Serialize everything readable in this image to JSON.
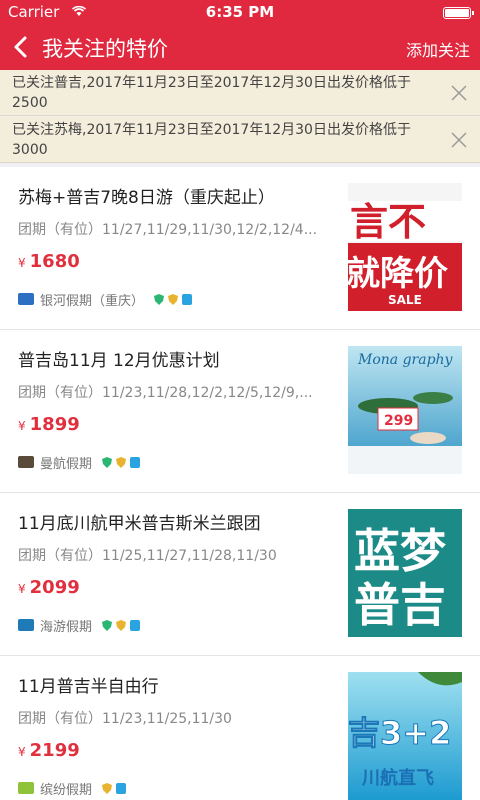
{
  "status_bar": {
    "carrier": "Carrier",
    "time": "6:35 PM"
  },
  "nav": {
    "title": "我关注的特价",
    "right_action": "添加关注"
  },
  "notices": [
    {
      "text": "已关注普吉,2017年11月23日至2017年12月30日出发价格低于2500"
    },
    {
      "text": "已关注苏梅,2017年11月23日至2017年12月30日出发价格低于3000"
    }
  ],
  "items": [
    {
      "name": "苏梅+普吉7晚8日游（重庆起止）",
      "dates": "团期（有位）11/27,11/29,11/30,12/2,12/4...",
      "currency": "¥",
      "price": "1680",
      "agency": "银河假期（重庆）",
      "thumb": {
        "line1": "言不",
        "line2": "就降价",
        "tag": "SALE"
      }
    },
    {
      "name": "普吉岛11月 12月优惠计划",
      "dates": "团期（有位）11/23,11/28,12/2,12/5,12/9,...",
      "currency": "¥",
      "price": "1899",
      "agency": "曼航假期",
      "thumb": {
        "price": "299"
      }
    },
    {
      "name": "11月底川航甲米普吉斯米兰跟团",
      "dates": "团期（有位）11/25,11/27,11/28,11/30",
      "currency": "¥",
      "price": "2099",
      "agency": "海游假期",
      "thumb": {
        "line1": "蓝梦",
        "line2": "普吉"
      }
    },
    {
      "name": "11月普吉半自由行",
      "dates": "团期（有位）11/23,11/25,11/30",
      "currency": "¥",
      "price": "2199",
      "agency": "缤纷假期",
      "thumb": {
        "line1": "吉3+2",
        "line2": "川航直飞"
      }
    }
  ],
  "colors": {
    "brand_red": "#e0283f",
    "price_red": "#e22f3e",
    "notice_bg": "#f3eddc"
  }
}
